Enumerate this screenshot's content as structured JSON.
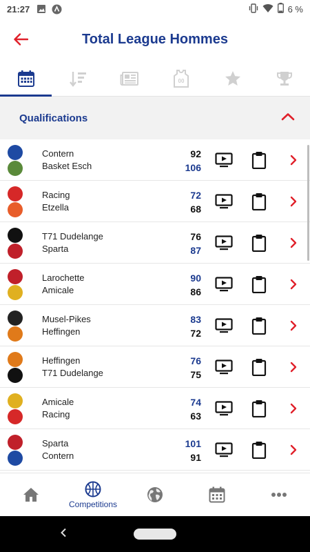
{
  "status_bar": {
    "time": "21:27",
    "battery": "6 %"
  },
  "header": {
    "title": "Total League Hommes"
  },
  "tabs": [
    {
      "icon": "calendar-icon",
      "active": true
    },
    {
      "icon": "sort-icon",
      "active": false
    },
    {
      "icon": "news-icon",
      "active": false
    },
    {
      "icon": "jersey-icon",
      "active": false
    },
    {
      "icon": "star-icon",
      "active": false
    },
    {
      "icon": "trophy-icon",
      "active": false
    }
  ],
  "section": {
    "label": "Qualifications"
  },
  "games": [
    {
      "home": "Contern",
      "away": "Basket Esch",
      "home_score": "92",
      "away_score": "106",
      "winner": "away",
      "home_logo": "#1e4aa3",
      "away_logo": "#5a8a3a"
    },
    {
      "home": "Racing",
      "away": "Etzella",
      "home_score": "72",
      "away_score": "68",
      "winner": "home",
      "home_logo": "#d62828",
      "away_logo": "#e85d2a"
    },
    {
      "home": "T71 Dudelange",
      "away": "Sparta",
      "home_score": "76",
      "away_score": "87",
      "winner": "away",
      "home_logo": "#111111",
      "away_logo": "#c0202a"
    },
    {
      "home": "Larochette",
      "away": "Amicale",
      "home_score": "90",
      "away_score": "86",
      "winner": "home",
      "home_logo": "#c0202a",
      "away_logo": "#e0b020"
    },
    {
      "home": "Musel-Pikes",
      "away": "Heffingen",
      "home_score": "83",
      "away_score": "72",
      "winner": "home",
      "home_logo": "#222222",
      "away_logo": "#e07a1a"
    },
    {
      "home": "Heffingen",
      "away": "T71 Dudelange",
      "home_score": "76",
      "away_score": "75",
      "winner": "home",
      "home_logo": "#e07a1a",
      "away_logo": "#111111"
    },
    {
      "home": "Amicale",
      "away": "Racing",
      "home_score": "74",
      "away_score": "63",
      "winner": "home",
      "home_logo": "#e0b020",
      "away_logo": "#d62828"
    },
    {
      "home": "Sparta",
      "away": "Contern",
      "home_score": "101",
      "away_score": "91",
      "winner": "home",
      "home_logo": "#c0202a",
      "away_logo": "#1e4aa3"
    }
  ],
  "bottom_nav": [
    {
      "icon": "home-icon",
      "label": ""
    },
    {
      "icon": "basketball-icon",
      "label": "Competitions",
      "active": true
    },
    {
      "icon": "globe-icon",
      "label": ""
    },
    {
      "icon": "calendar-icon",
      "label": ""
    },
    {
      "icon": "more-icon",
      "label": ""
    }
  ],
  "colors": {
    "primary": "#1b3a8f",
    "accent": "#e0202a",
    "inactive_icon": "#d0d0d0"
  }
}
